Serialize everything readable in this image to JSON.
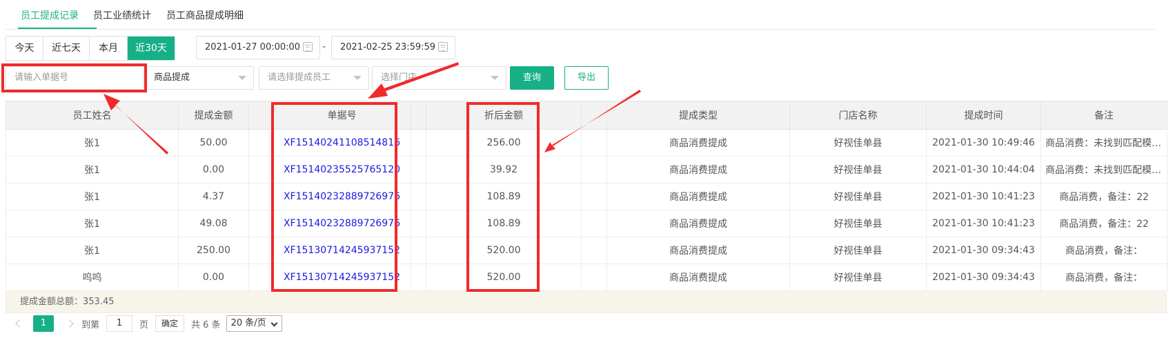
{
  "tabs": [
    {
      "label": "员工提成记录",
      "active": true
    },
    {
      "label": "员工业绩统计",
      "active": false
    },
    {
      "label": "员工商品提成明细",
      "active": false
    }
  ],
  "quick_dates": [
    {
      "label": "今天",
      "active": false
    },
    {
      "label": "近七天",
      "active": false
    },
    {
      "label": "本月",
      "active": false
    },
    {
      "label": "近30天",
      "active": true
    }
  ],
  "date_range": {
    "start": "2021-01-27 00:00:00",
    "separator": "-",
    "end": "2021-02-25 23:59:59"
  },
  "filters": {
    "order_no_placeholder": "请输入单据号",
    "commission_type_value": "商品提成",
    "employee_placeholder": "请选择提成员工",
    "store_placeholder": "选择门店",
    "query_label": "查询",
    "export_label": "导出"
  },
  "table": {
    "columns": [
      "员工姓名",
      "提成金额",
      "",
      "单据号",
      "",
      "折后金额",
      "",
      "提成类型",
      "门店名称",
      "提成时间",
      "备注"
    ],
    "rows": [
      {
        "employee": "张1",
        "amount": "50.00",
        "order_no": "XF15140241108514816",
        "discounted": "256.00",
        "type": "商品消费提成",
        "store": "好视佳单县",
        "time": "2021-01-30 10:49:46",
        "note": "商品消费：未找到匹配模版，备注："
      },
      {
        "employee": "张1",
        "amount": "0.00",
        "order_no": "XF15140235525765120",
        "discounted": "39.92",
        "type": "商品消费提成",
        "store": "好视佳单县",
        "time": "2021-01-30 10:44:04",
        "note": "商品消费：未找到匹配模版，备注:..."
      },
      {
        "employee": "张1",
        "amount": "4.37",
        "order_no": "XF15140232889726976",
        "discounted": "108.89",
        "type": "商品消费提成",
        "store": "好视佳单县",
        "time": "2021-01-30 10:41:23",
        "note": "商品消费，备注：22"
      },
      {
        "employee": "张1",
        "amount": "49.08",
        "order_no": "XF15140232889726976",
        "discounted": "108.89",
        "type": "商品消费提成",
        "store": "好视佳单县",
        "time": "2021-01-30 10:41:23",
        "note": "商品消费，备注：22"
      },
      {
        "employee": "张1",
        "amount": "250.00",
        "order_no": "XF15130714245937152",
        "discounted": "520.00",
        "type": "商品消费提成",
        "store": "好视佳单县",
        "time": "2021-01-30 09:34:43",
        "note": "商品消费，备注："
      },
      {
        "employee": "呜呜",
        "amount": "0.00",
        "order_no": "XF15130714245937152",
        "discounted": "520.00",
        "type": "商品消费提成",
        "store": "好视佳单县",
        "time": "2021-01-30 09:34:43",
        "note": "商品消费，备注："
      }
    ],
    "summary": "提成金额总额：353.45"
  },
  "pagination": {
    "current_page": "1",
    "goto_label": "到第",
    "goto_value": "1",
    "page_unit": "页",
    "confirm_label": "确定",
    "total_label": "共 6 条",
    "page_size": "20 条/页"
  },
  "colors": {
    "accent": "#17b086",
    "link": "#1a1ae0",
    "annotation": "#f02a2a"
  }
}
